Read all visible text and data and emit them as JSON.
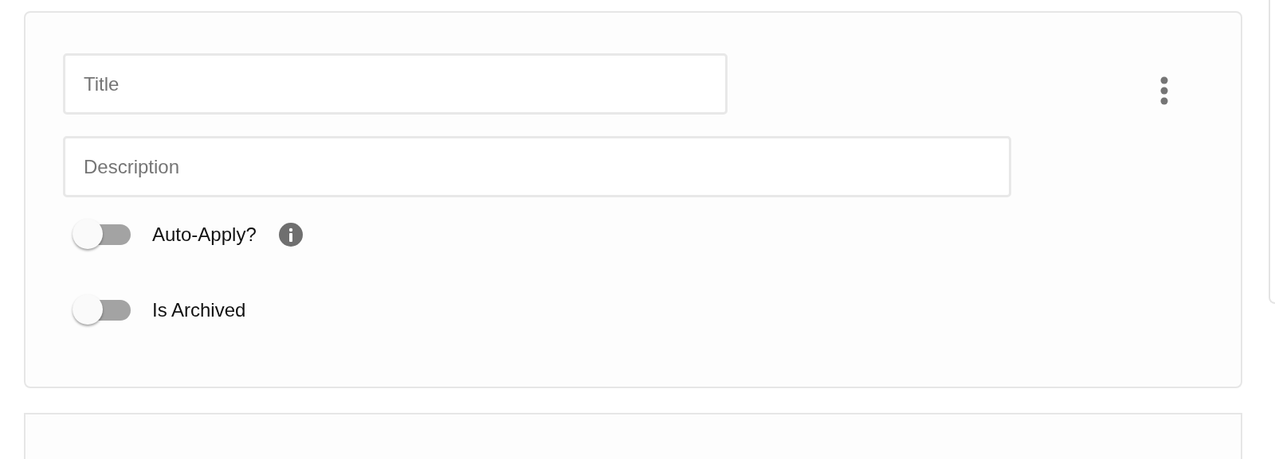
{
  "fields": [
    {
      "placeholder": "Title",
      "kind": "short"
    },
    {
      "placeholder": "Description",
      "kind": "long"
    }
  ],
  "toggles": [
    {
      "label": "Auto-Apply?",
      "on": false,
      "info": true
    },
    {
      "label": "Is Archived",
      "on": false,
      "info": false
    }
  ]
}
